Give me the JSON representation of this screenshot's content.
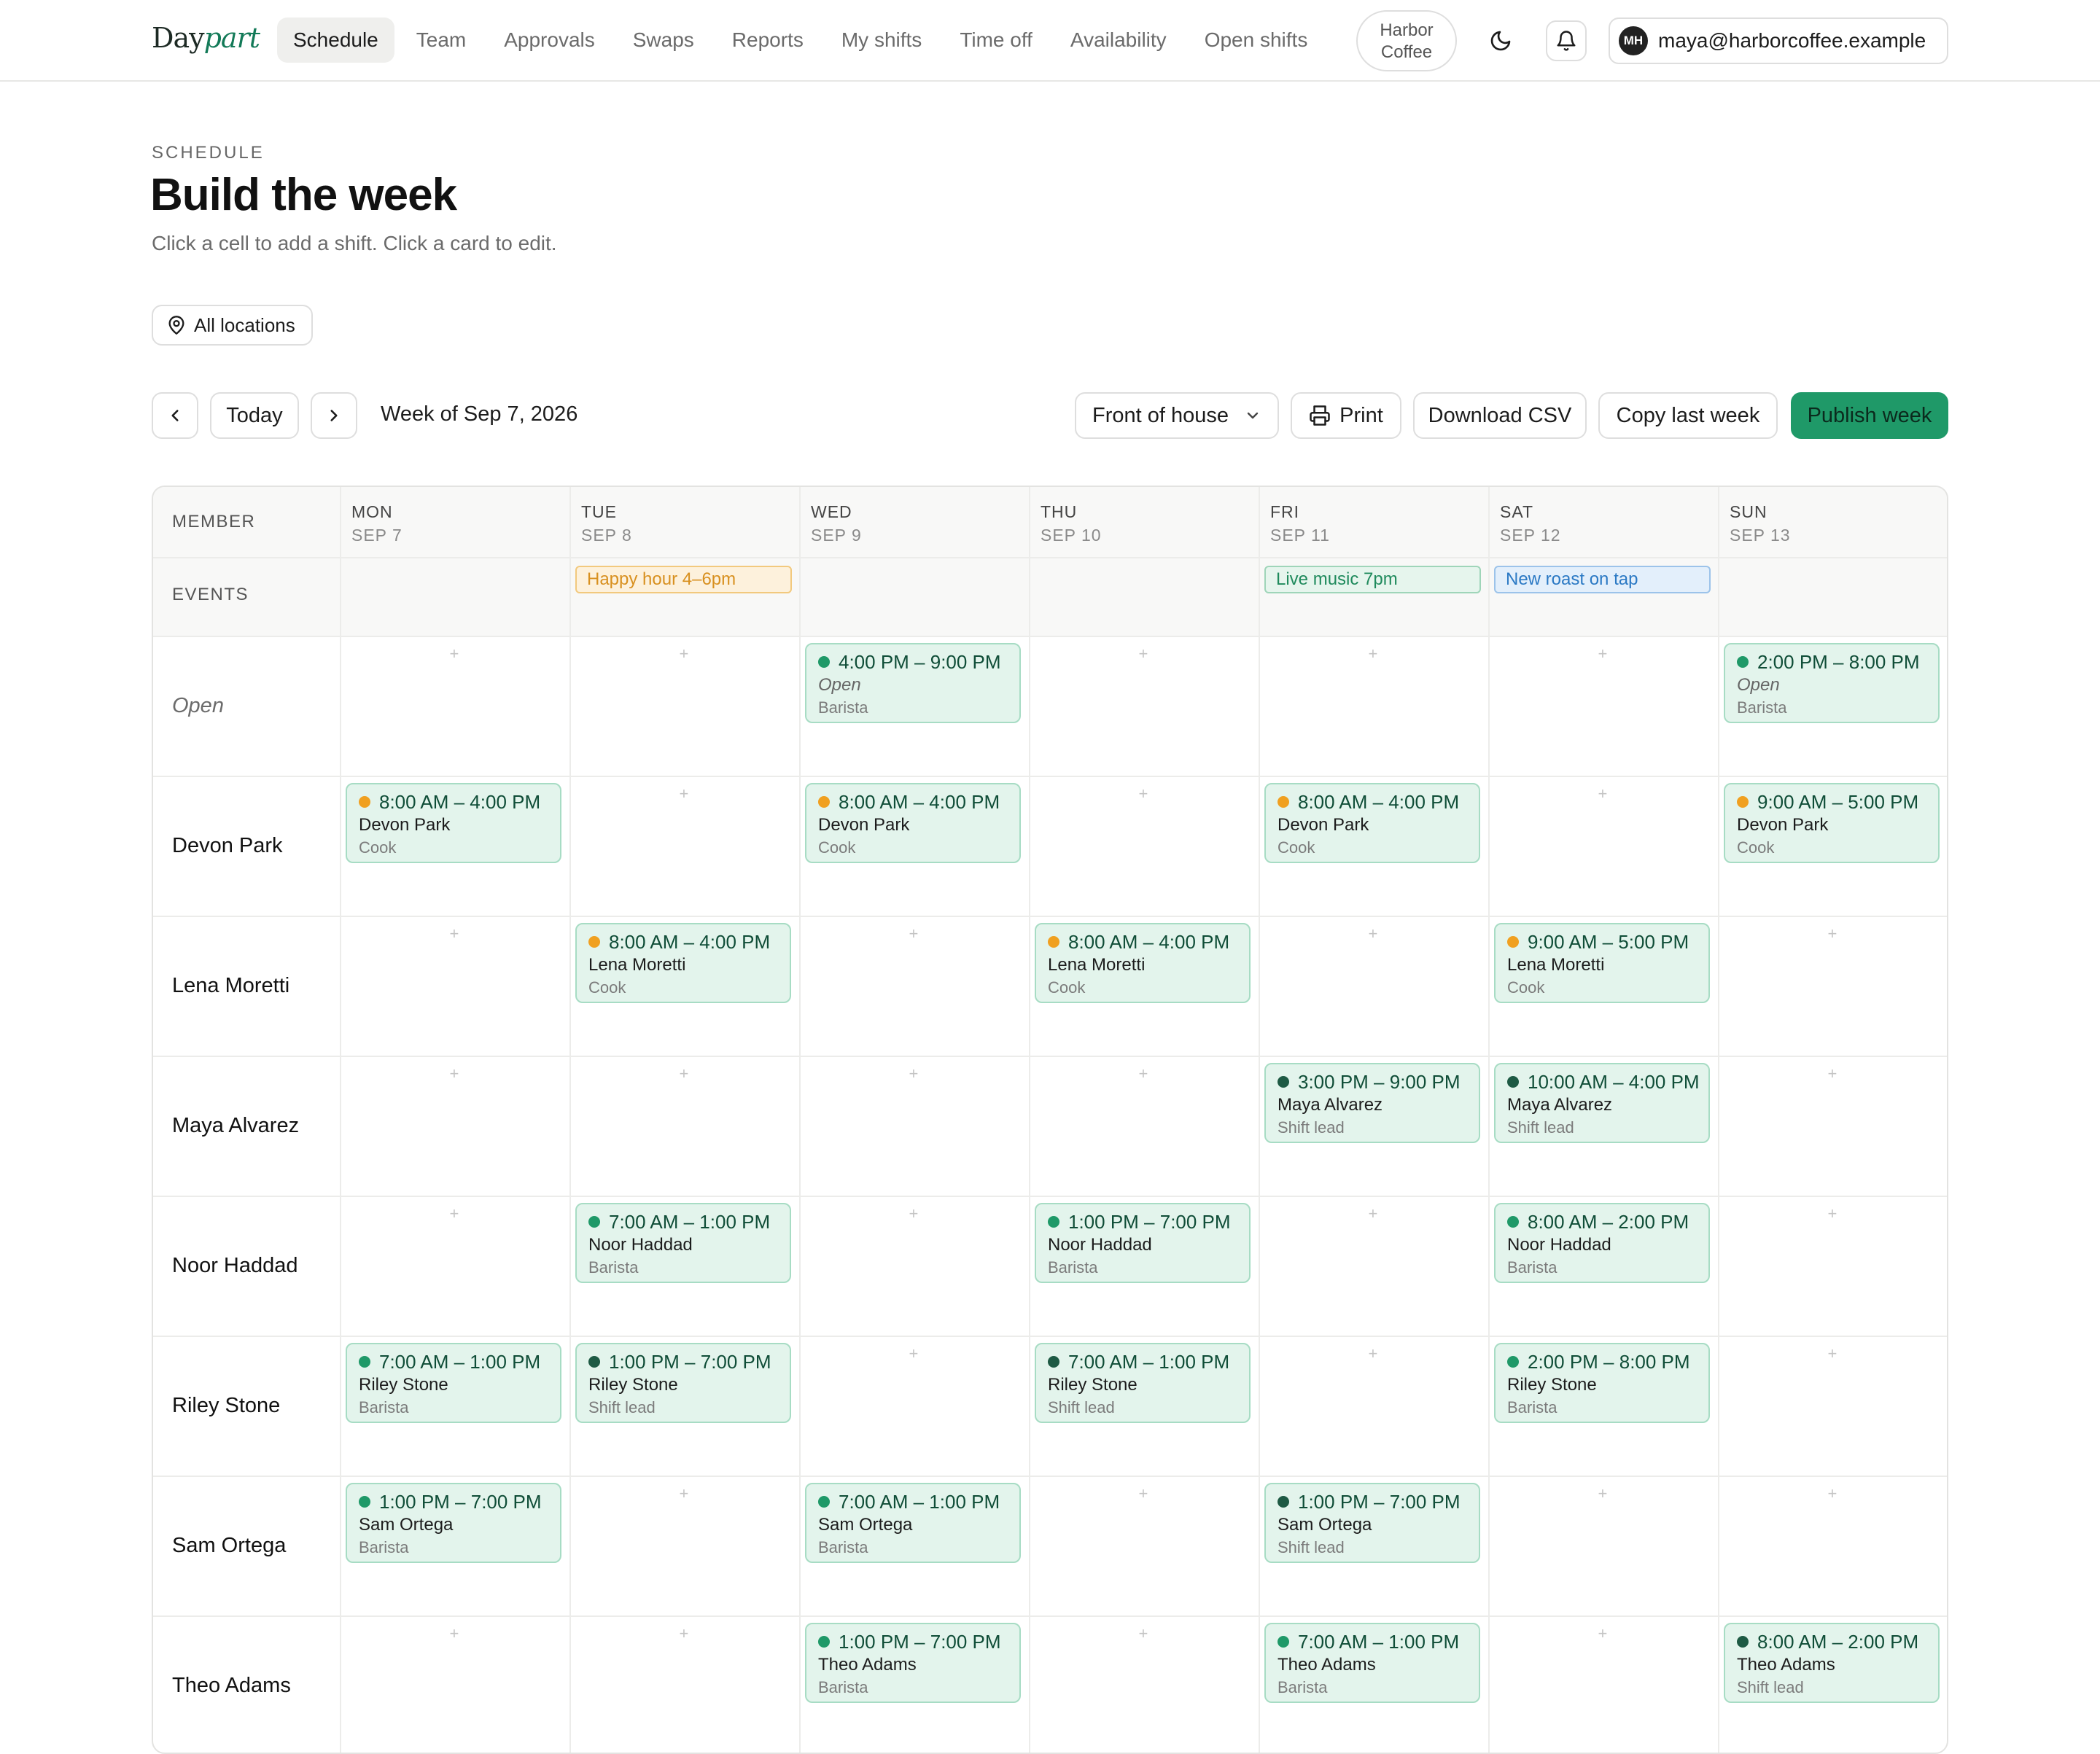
{
  "app": {
    "logo_a": "Day",
    "logo_b": "part",
    "nav": [
      {
        "label": "Schedule",
        "active": true
      },
      {
        "label": "Team"
      },
      {
        "label": "Approvals"
      },
      {
        "label": "Swaps"
      },
      {
        "label": "Reports"
      },
      {
        "label": "My shifts"
      },
      {
        "label": "Time off"
      },
      {
        "label": "Availability"
      },
      {
        "label": "Open shifts"
      }
    ],
    "org_line1": "Harbor",
    "org_line2": "Coffee",
    "user_initials": "MH",
    "user_email": "maya@harborcoffee.example"
  },
  "page": {
    "eyebrow": "SCHEDULE",
    "title": "Build the week",
    "subtitle": "Click a cell to add a shift. Click a card to edit.",
    "location_filter": "All locations"
  },
  "toolbar": {
    "today": "Today",
    "week_label": "Week of Sep 7, 2026",
    "area_select": "Front of house",
    "print": "Print",
    "download_csv": "Download CSV",
    "copy_last_week": "Copy last week",
    "publish": "Publish week"
  },
  "colors": {
    "brand": "#1f9968",
    "shift_bg": "#e3f4ec",
    "dot_green": "#1f9968",
    "dot_orange": "#f0a020",
    "dot_dark": "#1e5a44"
  },
  "grid": {
    "member_header": "MEMBER",
    "events_header": "EVENTS",
    "days": [
      {
        "name": "MON",
        "date": "SEP 7"
      },
      {
        "name": "TUE",
        "date": "SEP 8"
      },
      {
        "name": "WED",
        "date": "SEP 9"
      },
      {
        "name": "THU",
        "date": "SEP 10"
      },
      {
        "name": "FRI",
        "date": "SEP 11"
      },
      {
        "name": "SAT",
        "date": "SEP 12"
      },
      {
        "name": "SUN",
        "date": "SEP 13"
      }
    ],
    "events": [
      {
        "day": 1,
        "label": "Happy hour 4–6pm",
        "kind": "orange"
      },
      {
        "day": 4,
        "label": "Live music 7pm",
        "kind": "green"
      },
      {
        "day": 5,
        "label": "New roast on tap",
        "kind": "blue"
      }
    ],
    "rows": [
      {
        "name": "Open",
        "open": true,
        "shifts": [
          {
            "day": 2,
            "time": "4:00 PM – 9:00 PM",
            "who": "Open",
            "role": "Barista",
            "dot": "green"
          },
          {
            "day": 6,
            "time": "2:00 PM – 8:00 PM",
            "who": "Open",
            "role": "Barista",
            "dot": "green"
          }
        ]
      },
      {
        "name": "Devon Park",
        "shifts": [
          {
            "day": 0,
            "time": "8:00 AM – 4:00 PM",
            "who": "Devon Park",
            "role": "Cook",
            "dot": "orange"
          },
          {
            "day": 2,
            "time": "8:00 AM – 4:00 PM",
            "who": "Devon Park",
            "role": "Cook",
            "dot": "orange"
          },
          {
            "day": 4,
            "time": "8:00 AM – 4:00 PM",
            "who": "Devon Park",
            "role": "Cook",
            "dot": "orange"
          },
          {
            "day": 6,
            "time": "9:00 AM – 5:00 PM",
            "who": "Devon Park",
            "role": "Cook",
            "dot": "orange"
          }
        ]
      },
      {
        "name": "Lena Moretti",
        "shifts": [
          {
            "day": 1,
            "time": "8:00 AM – 4:00 PM",
            "who": "Lena Moretti",
            "role": "Cook",
            "dot": "orange"
          },
          {
            "day": 3,
            "time": "8:00 AM – 4:00 PM",
            "who": "Lena Moretti",
            "role": "Cook",
            "dot": "orange"
          },
          {
            "day": 5,
            "time": "9:00 AM – 5:00 PM",
            "who": "Lena Moretti",
            "role": "Cook",
            "dot": "orange"
          }
        ]
      },
      {
        "name": "Maya Alvarez",
        "shifts": [
          {
            "day": 4,
            "time": "3:00 PM – 9:00 PM",
            "who": "Maya Alvarez",
            "role": "Shift lead",
            "dot": "dark"
          },
          {
            "day": 5,
            "time": "10:00 AM – 4:00 PM",
            "who": "Maya Alvarez",
            "role": "Shift lead",
            "dot": "dark"
          }
        ]
      },
      {
        "name": "Noor Haddad",
        "shifts": [
          {
            "day": 1,
            "time": "7:00 AM – 1:00 PM",
            "who": "Noor Haddad",
            "role": "Barista",
            "dot": "green"
          },
          {
            "day": 3,
            "time": "1:00 PM – 7:00 PM",
            "who": "Noor Haddad",
            "role": "Barista",
            "dot": "green"
          },
          {
            "day": 5,
            "time": "8:00 AM – 2:00 PM",
            "who": "Noor Haddad",
            "role": "Barista",
            "dot": "green"
          }
        ]
      },
      {
        "name": "Riley Stone",
        "shifts": [
          {
            "day": 0,
            "time": "7:00 AM – 1:00 PM",
            "who": "Riley Stone",
            "role": "Barista",
            "dot": "green"
          },
          {
            "day": 1,
            "time": "1:00 PM – 7:00 PM",
            "who": "Riley Stone",
            "role": "Shift lead",
            "dot": "dark"
          },
          {
            "day": 3,
            "time": "7:00 AM – 1:00 PM",
            "who": "Riley Stone",
            "role": "Shift lead",
            "dot": "dark"
          },
          {
            "day": 5,
            "time": "2:00 PM – 8:00 PM",
            "who": "Riley Stone",
            "role": "Barista",
            "dot": "green"
          }
        ]
      },
      {
        "name": "Sam Ortega",
        "shifts": [
          {
            "day": 0,
            "time": "1:00 PM – 7:00 PM",
            "who": "Sam Ortega",
            "role": "Barista",
            "dot": "green"
          },
          {
            "day": 2,
            "time": "7:00 AM – 1:00 PM",
            "who": "Sam Ortega",
            "role": "Barista",
            "dot": "green"
          },
          {
            "day": 4,
            "time": "1:00 PM – 7:00 PM",
            "who": "Sam Ortega",
            "role": "Shift lead",
            "dot": "dark"
          }
        ]
      },
      {
        "name": "Theo Adams",
        "shifts": [
          {
            "day": 2,
            "time": "1:00 PM – 7:00 PM",
            "who": "Theo Adams",
            "role": "Barista",
            "dot": "green"
          },
          {
            "day": 4,
            "time": "7:00 AM – 1:00 PM",
            "who": "Theo Adams",
            "role": "Barista",
            "dot": "green"
          },
          {
            "day": 6,
            "time": "8:00 AM – 2:00 PM",
            "who": "Theo Adams",
            "role": "Shift lead",
            "dot": "dark"
          }
        ]
      }
    ]
  }
}
